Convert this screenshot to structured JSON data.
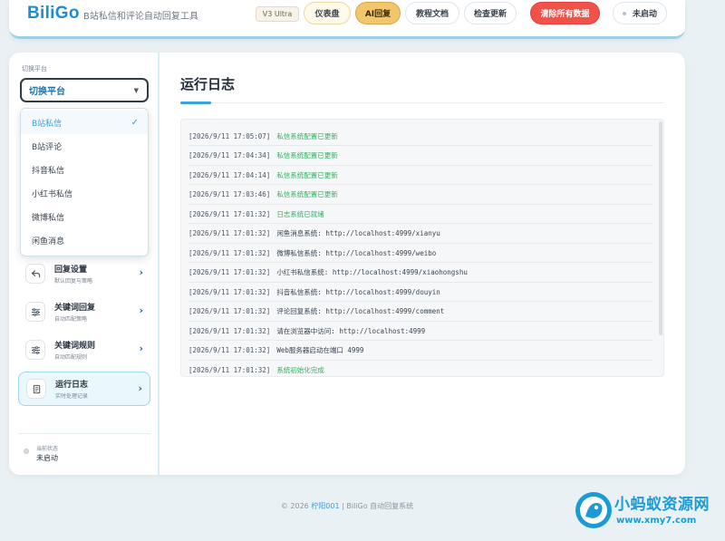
{
  "header": {
    "logo": "BiliGo",
    "subtitle": "B站私信和评论自动回复工具",
    "version": "V3 Ultra",
    "buttons": {
      "dashboard": "仪表盘",
      "ai": "AI回复",
      "docs": "教程文档",
      "update": "检查更新",
      "clear": "清除所有数据",
      "status": "未启动"
    }
  },
  "sidebar": {
    "section_label": "切换平台",
    "select_value": "切换平台",
    "dropdown": [
      {
        "label": "B站私信",
        "selected": true
      },
      {
        "label": "B站评论",
        "selected": false
      },
      {
        "label": "抖音私信",
        "selected": false
      },
      {
        "label": "小红书私信",
        "selected": false
      },
      {
        "label": "微博私信",
        "selected": false
      },
      {
        "label": "闲鱼消息",
        "selected": false
      }
    ],
    "check_mark": "✓",
    "menu": [
      {
        "title": "回复设置",
        "desc": "默认回复与策略",
        "icon": "reply-icon"
      },
      {
        "title": "关键词回复",
        "desc": "自动匹配策略",
        "icon": "sliders-icon"
      },
      {
        "title": "关键词规则",
        "desc": "自动匹配规则",
        "icon": "sliders-icon"
      },
      {
        "title": "运行日志",
        "desc": "实时处理记录",
        "icon": "document-icon"
      }
    ],
    "status_label": "当前状态",
    "status_value": "未启动"
  },
  "main": {
    "title": "运行日志",
    "logs": [
      {
        "time": "[2026/9/11 17:05:07]",
        "msg": "私信系统配置已更新",
        "color": "green"
      },
      {
        "time": "[2026/9/11 17:04:34]",
        "msg": "私信系统配置已更新",
        "color": "green"
      },
      {
        "time": "[2026/9/11 17:04:14]",
        "msg": "私信系统配置已更新",
        "color": "green"
      },
      {
        "time": "[2026/9/11 17:03:46]",
        "msg": "私信系统配置已更新",
        "color": "green"
      },
      {
        "time": "[2026/9/11 17:01:32]",
        "msg": "日志系统已就绪",
        "color": "green"
      },
      {
        "time": "[2026/9/11 17:01:32]",
        "msg": "闲鱼消息系统: http://localhost:4999/xianyu",
        "color": "default"
      },
      {
        "time": "[2026/9/11 17:01:32]",
        "msg": "微博私信系统: http://localhost:4999/weibo",
        "color": "default"
      },
      {
        "time": "[2026/9/11 17:01:32]",
        "msg": "小红书私信系统: http://localhost:4999/xiaohongshu",
        "color": "default"
      },
      {
        "time": "[2026/9/11 17:01:32]",
        "msg": "抖音私信系统: http://localhost:4999/douyin",
        "color": "default"
      },
      {
        "time": "[2026/9/11 17:01:32]",
        "msg": "评论回复系统: http://localhost:4999/comment",
        "color": "default"
      },
      {
        "time": "[2026/9/11 17:01:32]",
        "msg": "请在浏览器中访问: http://localhost:4999",
        "color": "default"
      },
      {
        "time": "[2026/9/11 17:01:32]",
        "msg": "Web服务器启动在端口 4999",
        "color": "default"
      },
      {
        "time": "[2026/9/11 17:01:32]",
        "msg": "系统初始化完成",
        "color": "green"
      }
    ]
  },
  "footer": {
    "prefix": "© 2026 ",
    "author": "柠阳001",
    "suffix": " | BiliGo 自动回复系统"
  },
  "watermark": {
    "title": "小蚂蚁资源网",
    "url": "www.xmy7.com"
  },
  "colors": {
    "accent": "#3aa3d9",
    "green_log": "#2fb35a",
    "danger": "#f0524a",
    "gold": "#f2c66b"
  }
}
